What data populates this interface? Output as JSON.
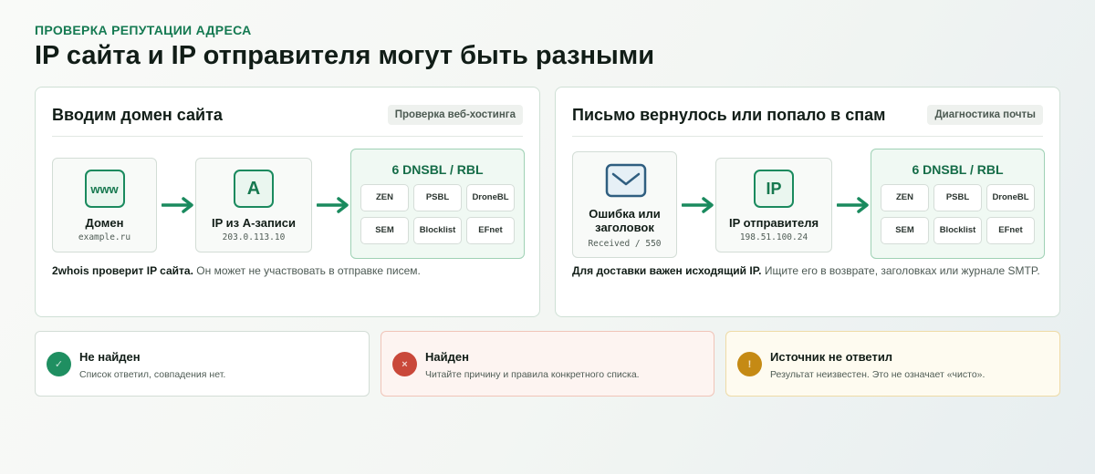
{
  "header": {
    "eyebrow": "ПРОВЕРКА РЕПУТАЦИИ АДРЕСА",
    "title": "IP сайта и IP отправителя могут быть разными"
  },
  "colors": {
    "accent": "#1a8a5e",
    "found": "#c9483a",
    "not_found": "#1f8f61",
    "no_answer": "#c58a14"
  },
  "left_panel": {
    "title": "Вводим домен сайта",
    "tag": "Проверка веб-хостинга",
    "source": {
      "icon": "www-icon",
      "icon_text": "www",
      "label": "Домен",
      "sub": "example.ru"
    },
    "record": {
      "icon": "a-record-icon",
      "icon_text": "A",
      "label": "IP из A-записи",
      "sub": "203.0.113.10"
    },
    "dnsbl": {
      "title": "6 DNSBL / RBL",
      "lists": [
        "ZEN",
        "PSBL",
        "DroneBL",
        "SEM",
        "Blocklist",
        "EFnet"
      ]
    },
    "note_bold": "2whois проверит IP сайта.",
    "note": " Он может не участвовать в отправке писем."
  },
  "right_panel": {
    "title": "Письмо вернулось или попало в спам",
    "tag": "Диагностика почты",
    "source": {
      "icon": "envelope-icon",
      "label_line1": "Ошибка или",
      "label_line2": "заголовок",
      "sub": "Received / 550"
    },
    "record": {
      "icon": "ip-icon",
      "icon_text": "IP",
      "label": "IP отправителя",
      "sub": "198.51.100.24"
    },
    "dnsbl": {
      "title": "6 DNSBL / RBL",
      "lists": [
        "ZEN",
        "PSBL",
        "DroneBL",
        "SEM",
        "Blocklist",
        "EFnet"
      ]
    },
    "note_bold": "Для доставки важен исходящий IP.",
    "note": " Ищите его в возврате, заголовках или журнале SMTP."
  },
  "statuses": [
    {
      "icon": "check-icon",
      "icon_text": "✓",
      "title": "Не найден",
      "desc": "Список ответил, совпадения нет."
    },
    {
      "icon": "cross-icon",
      "icon_text": "×",
      "title": "Найден",
      "desc": "Читайте причину и правила конкретного списка."
    },
    {
      "icon": "exclamation-icon",
      "icon_text": "!",
      "title": "Источник не ответил",
      "desc": "Результат неизвестен. Это не означает «чисто»."
    }
  ]
}
